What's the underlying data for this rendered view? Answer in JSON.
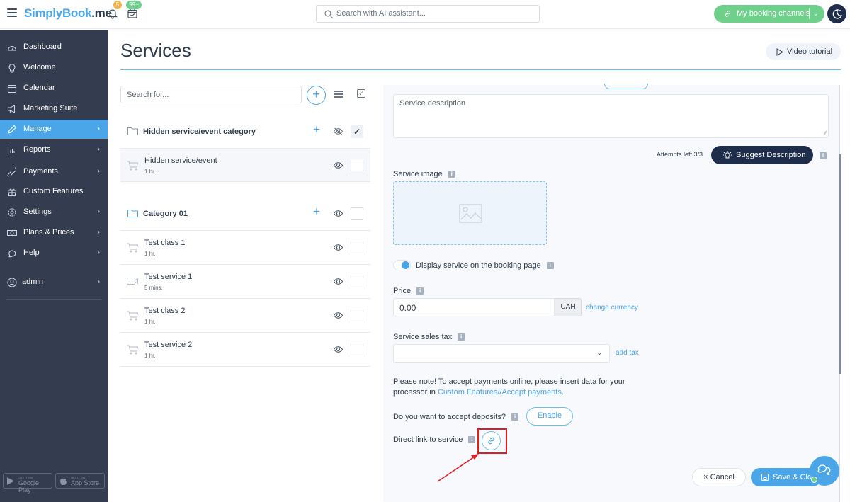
{
  "header": {
    "logo_main": "SimplyBook",
    "logo_suffix": ".me",
    "notifications_count": "5",
    "bookings_count": "99+",
    "search_placeholder": "Search with AI assistant...",
    "booking_channels_label": "My booking channels",
    "colors": {
      "accent": "#4aa6e8",
      "green": "#6fd08b",
      "dark": "#1e2e4a",
      "sidebar": "#333d4f"
    }
  },
  "sidebar": {
    "items": [
      {
        "label": "Dashboard",
        "icon": "dashboard-icon",
        "arrow": false,
        "active": false
      },
      {
        "label": "Welcome",
        "icon": "lightbulb-icon",
        "arrow": false,
        "active": false
      },
      {
        "label": "Calendar",
        "icon": "calendar-icon",
        "arrow": false,
        "active": false
      },
      {
        "label": "Marketing Suite",
        "icon": "megaphone-icon",
        "arrow": false,
        "active": false
      },
      {
        "label": "Manage",
        "icon": "pencil-icon",
        "arrow": true,
        "active": true
      },
      {
        "label": "Reports",
        "icon": "bar-chart-icon",
        "arrow": true,
        "active": false
      },
      {
        "label": "Payments",
        "icon": "payments-icon",
        "arrow": true,
        "active": false
      },
      {
        "label": "Custom Features",
        "icon": "gift-icon",
        "arrow": false,
        "active": false
      },
      {
        "label": "Settings",
        "icon": "gear-icon",
        "arrow": true,
        "active": false
      },
      {
        "label": "Plans & Prices",
        "icon": "banknote-icon",
        "arrow": true,
        "active": false
      },
      {
        "label": "Help",
        "icon": "chat-bubble-icon",
        "arrow": true,
        "active": false
      }
    ],
    "user": {
      "label": "admin"
    },
    "stores": {
      "google_small": "GET IT ON",
      "google_big": "Google Play",
      "apple_small": "GET IT ON",
      "apple_big": "App Store"
    }
  },
  "page": {
    "title": "Services",
    "video_tutorial_label": "Video tutorial"
  },
  "service_list": {
    "search_placeholder": "Search for...",
    "categories": [
      {
        "name": "Hidden service/event category",
        "visible": false,
        "checked": true,
        "services": [
          {
            "name": "Hidden service/event",
            "duration": "1 hr.",
            "type": "cart",
            "checked": false
          }
        ]
      },
      {
        "name": "Category 01",
        "visible": true,
        "checked": false,
        "services": [
          {
            "name": "Test class 1",
            "duration": "1 hr.",
            "type": "cart",
            "checked": false
          },
          {
            "name": "Test service 1",
            "duration": "5 mins.",
            "type": "video",
            "checked": false
          },
          {
            "name": "Test class 2",
            "duration": "1 hr.",
            "type": "cart",
            "checked": false
          },
          {
            "name": "Test service 2",
            "duration": "1 hr.",
            "type": "cart",
            "checked": false
          }
        ]
      }
    ]
  },
  "editor": {
    "description_placeholder": "Service description",
    "attempts_left": "Attempts left 3/3",
    "suggest_label": "Suggest Description",
    "service_image_label": "Service image",
    "display_toggle_label": "Display service on the booking page",
    "display_toggle_on": true,
    "price_label": "Price",
    "price_value": "0.00",
    "currency": "UAH",
    "change_currency_label": "change currency",
    "tax_label": "Service sales tax",
    "tax_value": "",
    "add_tax_label": "add tax",
    "note_text": "Please note! To accept payments online, please insert data for your processor in ",
    "note_link": "Custom Features//Accept payments.",
    "deposits_label": "Do you want to accept deposits?",
    "enable_label": "Enable",
    "direct_link_label": "Direct link to service",
    "cancel_label": "Cancel",
    "save_label": "Save & Close",
    "info_glyph": "i"
  }
}
